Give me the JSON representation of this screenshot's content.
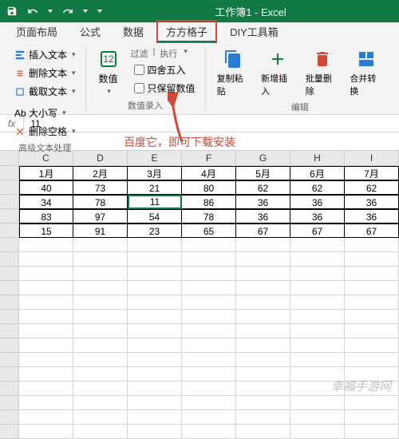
{
  "titlebar": {
    "title": "工作簿1 - Excel"
  },
  "ribbon": {
    "tabs": [
      "页面布局",
      "公式",
      "数据",
      "方方格子",
      "DIY工具箱"
    ],
    "highlighted_tab_index": 3,
    "group1": {
      "label": "高级文本处理",
      "btns": [
        "插入文本",
        "删除文本",
        "截取文本"
      ],
      "btns2": [
        "Ab 大小写",
        "删除空格"
      ]
    },
    "group2": {
      "label": "数值录入",
      "hdr1": "过滤",
      "hdr2": "执行",
      "chk1": "四舍五入",
      "chk2": "只保留数值",
      "num_btn": "数值"
    },
    "group3": {
      "label": "编辑",
      "btns": [
        "复制粘贴",
        "新增插入",
        "批量删除",
        "合并转换"
      ]
    }
  },
  "formula_bar": {
    "value": "11"
  },
  "annotation": {
    "text": "百度它，即可下载安装"
  },
  "grid": {
    "col_letters": [
      "C",
      "D",
      "E",
      "F",
      "G",
      "H",
      "I"
    ],
    "header_row": [
      "1月",
      "2月",
      "3月",
      "4月",
      "5月",
      "6月",
      "7月"
    ],
    "data": [
      [
        "40",
        "73",
        "21",
        "80",
        "62",
        "62",
        "62"
      ],
      [
        "34",
        "78",
        "11",
        "86",
        "36",
        "36",
        "36"
      ],
      [
        "83",
        "97",
        "54",
        "78",
        "36",
        "36",
        "36"
      ],
      [
        "15",
        "91",
        "23",
        "65",
        "67",
        "67",
        "67"
      ]
    ],
    "selected": {
      "row": 1,
      "col": 2
    },
    "empty_rows": 14
  },
  "watermark": "幸福手游网"
}
